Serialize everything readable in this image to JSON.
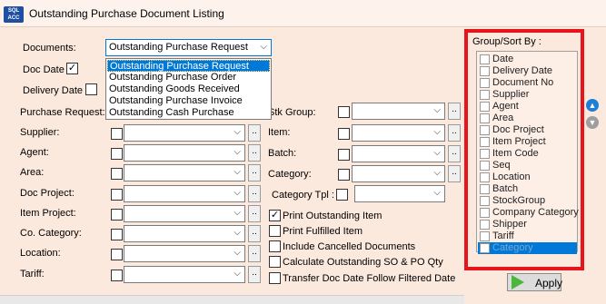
{
  "window": {
    "title": "Outstanding Purchase Document Listing",
    "app_icon_text": "SQL ACC"
  },
  "documents": {
    "label": "Documents:",
    "selected": "Outstanding Purchase Request",
    "options": [
      "Outstanding Purchase Request",
      "Outstanding Purchase Order",
      "Outstanding Goods Received",
      "Outstanding Purchase Invoice",
      "Outstanding Cash Purchase"
    ]
  },
  "doc_date": {
    "label": "Doc Date",
    "checked": "✓"
  },
  "delivery_date": {
    "label": "Delivery Date"
  },
  "left_labels": {
    "purchase_request": "Purchase Request:",
    "supplier": "Supplier:",
    "agent": "Agent:",
    "area": "Area:",
    "doc_project": "Doc Project:",
    "item_project": "Item Project:",
    "co_category": "Co. Category:",
    "location": "Location:",
    "tariff": "Tariff:"
  },
  "mid_labels": {
    "stk_group": "Stk Group:",
    "item": "Item:",
    "batch": "Batch:",
    "category": "Category:",
    "category_tpl": "Category Tpl :"
  },
  "options": {
    "print_outstanding": "Print Outstanding Item",
    "print_outstanding_check": "✓",
    "print_fulfilled": "Print Fulfilled Item",
    "include_cancelled": "Include Cancelled Documents",
    "calculate_outstanding": "Calculate Outstanding SO & PO Qty",
    "transfer_doc_date": "Transfer Doc Date Follow Filtered Date"
  },
  "group_sort": {
    "title": "Group/Sort By :",
    "items": [
      "Date",
      "Delivery Date",
      "Document No",
      "Supplier",
      "Agent",
      "Area",
      "Doc Project",
      "Item Project",
      "Item Code",
      "Seq",
      "Location",
      "Batch",
      "StockGroup",
      "Company Category",
      "Shipper",
      "Tariff",
      "Category"
    ]
  },
  "buttons": {
    "apply": "Apply",
    "dots": "..",
    "up_arrow": "▲",
    "down_arrow": "▼",
    "combo_arrow": "⌵"
  },
  "colors": {
    "background": "#fce9de",
    "selection": "#0078d7",
    "highlight_border": "#e8141c",
    "apply_icon": "#49b83a"
  }
}
